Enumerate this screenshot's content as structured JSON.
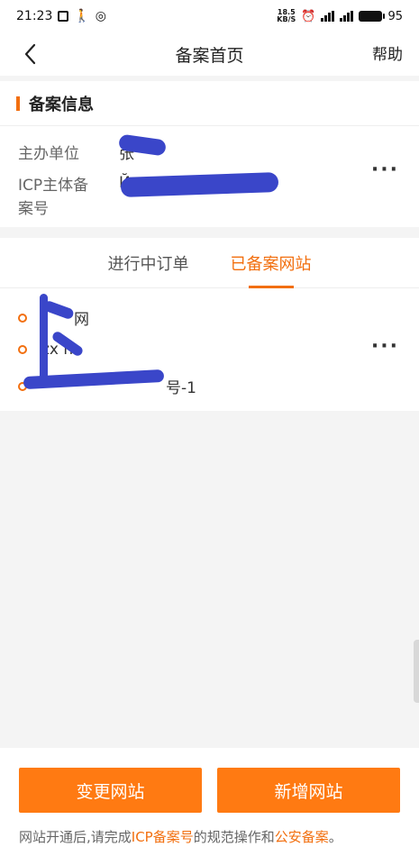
{
  "status_bar": {
    "time": "21:23",
    "speed_top": "18.5",
    "speed_bottom": "KB/S",
    "battery": "95"
  },
  "nav": {
    "title": "备案首页",
    "help": "帮助"
  },
  "info": {
    "section_title": "备案信息",
    "sponsor_label": "主办单位",
    "sponsor_value": "张",
    "icp_label_line1": "ICP主体备",
    "icp_label_line2": "案号",
    "icp_value": "Й"
  },
  "tabs": [
    {
      "label": "进行中订单",
      "active": false
    },
    {
      "label": "已备案网站",
      "active": true
    }
  ],
  "sites": [
    {
      "text": "网"
    },
    {
      "text": "zx n"
    },
    {
      "text": "号-1"
    }
  ],
  "buttons": {
    "change": "变更网站",
    "add": "新增网站"
  },
  "note": {
    "part1": "网站开通后,请完成",
    "link1": "ICP备案号",
    "part2": "的规范操作和",
    "link2": "公安备案",
    "part3": "。"
  },
  "colors": {
    "accent": "#f26f0f",
    "button": "#ff7a12",
    "redaction": "#3a46c9"
  }
}
